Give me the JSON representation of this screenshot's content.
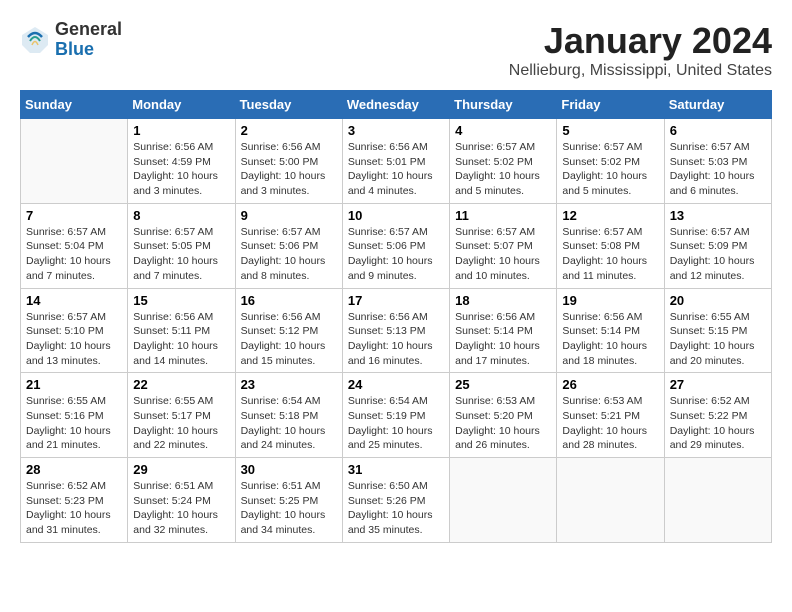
{
  "header": {
    "logo": {
      "general": "General",
      "blue": "Blue"
    },
    "month": "January 2024",
    "location": "Nellieburg, Mississippi, United States"
  },
  "calendar": {
    "weekdays": [
      "Sunday",
      "Monday",
      "Tuesday",
      "Wednesday",
      "Thursday",
      "Friday",
      "Saturday"
    ],
    "weeks": [
      [
        {
          "day": "",
          "sunrise": "",
          "sunset": "",
          "daylight": ""
        },
        {
          "day": "1",
          "sunrise": "Sunrise: 6:56 AM",
          "sunset": "Sunset: 4:59 PM",
          "daylight": "Daylight: 10 hours and 3 minutes."
        },
        {
          "day": "2",
          "sunrise": "Sunrise: 6:56 AM",
          "sunset": "Sunset: 5:00 PM",
          "daylight": "Daylight: 10 hours and 3 minutes."
        },
        {
          "day": "3",
          "sunrise": "Sunrise: 6:56 AM",
          "sunset": "Sunset: 5:01 PM",
          "daylight": "Daylight: 10 hours and 4 minutes."
        },
        {
          "day": "4",
          "sunrise": "Sunrise: 6:57 AM",
          "sunset": "Sunset: 5:02 PM",
          "daylight": "Daylight: 10 hours and 5 minutes."
        },
        {
          "day": "5",
          "sunrise": "Sunrise: 6:57 AM",
          "sunset": "Sunset: 5:02 PM",
          "daylight": "Daylight: 10 hours and 5 minutes."
        },
        {
          "day": "6",
          "sunrise": "Sunrise: 6:57 AM",
          "sunset": "Sunset: 5:03 PM",
          "daylight": "Daylight: 10 hours and 6 minutes."
        }
      ],
      [
        {
          "day": "7",
          "sunrise": "Sunrise: 6:57 AM",
          "sunset": "Sunset: 5:04 PM",
          "daylight": "Daylight: 10 hours and 7 minutes."
        },
        {
          "day": "8",
          "sunrise": "Sunrise: 6:57 AM",
          "sunset": "Sunset: 5:05 PM",
          "daylight": "Daylight: 10 hours and 7 minutes."
        },
        {
          "day": "9",
          "sunrise": "Sunrise: 6:57 AM",
          "sunset": "Sunset: 5:06 PM",
          "daylight": "Daylight: 10 hours and 8 minutes."
        },
        {
          "day": "10",
          "sunrise": "Sunrise: 6:57 AM",
          "sunset": "Sunset: 5:06 PM",
          "daylight": "Daylight: 10 hours and 9 minutes."
        },
        {
          "day": "11",
          "sunrise": "Sunrise: 6:57 AM",
          "sunset": "Sunset: 5:07 PM",
          "daylight": "Daylight: 10 hours and 10 minutes."
        },
        {
          "day": "12",
          "sunrise": "Sunrise: 6:57 AM",
          "sunset": "Sunset: 5:08 PM",
          "daylight": "Daylight: 10 hours and 11 minutes."
        },
        {
          "day": "13",
          "sunrise": "Sunrise: 6:57 AM",
          "sunset": "Sunset: 5:09 PM",
          "daylight": "Daylight: 10 hours and 12 minutes."
        }
      ],
      [
        {
          "day": "14",
          "sunrise": "Sunrise: 6:57 AM",
          "sunset": "Sunset: 5:10 PM",
          "daylight": "Daylight: 10 hours and 13 minutes."
        },
        {
          "day": "15",
          "sunrise": "Sunrise: 6:56 AM",
          "sunset": "Sunset: 5:11 PM",
          "daylight": "Daylight: 10 hours and 14 minutes."
        },
        {
          "day": "16",
          "sunrise": "Sunrise: 6:56 AM",
          "sunset": "Sunset: 5:12 PM",
          "daylight": "Daylight: 10 hours and 15 minutes."
        },
        {
          "day": "17",
          "sunrise": "Sunrise: 6:56 AM",
          "sunset": "Sunset: 5:13 PM",
          "daylight": "Daylight: 10 hours and 16 minutes."
        },
        {
          "day": "18",
          "sunrise": "Sunrise: 6:56 AM",
          "sunset": "Sunset: 5:14 PM",
          "daylight": "Daylight: 10 hours and 17 minutes."
        },
        {
          "day": "19",
          "sunrise": "Sunrise: 6:56 AM",
          "sunset": "Sunset: 5:14 PM",
          "daylight": "Daylight: 10 hours and 18 minutes."
        },
        {
          "day": "20",
          "sunrise": "Sunrise: 6:55 AM",
          "sunset": "Sunset: 5:15 PM",
          "daylight": "Daylight: 10 hours and 20 minutes."
        }
      ],
      [
        {
          "day": "21",
          "sunrise": "Sunrise: 6:55 AM",
          "sunset": "Sunset: 5:16 PM",
          "daylight": "Daylight: 10 hours and 21 minutes."
        },
        {
          "day": "22",
          "sunrise": "Sunrise: 6:55 AM",
          "sunset": "Sunset: 5:17 PM",
          "daylight": "Daylight: 10 hours and 22 minutes."
        },
        {
          "day": "23",
          "sunrise": "Sunrise: 6:54 AM",
          "sunset": "Sunset: 5:18 PM",
          "daylight": "Daylight: 10 hours and 24 minutes."
        },
        {
          "day": "24",
          "sunrise": "Sunrise: 6:54 AM",
          "sunset": "Sunset: 5:19 PM",
          "daylight": "Daylight: 10 hours and 25 minutes."
        },
        {
          "day": "25",
          "sunrise": "Sunrise: 6:53 AM",
          "sunset": "Sunset: 5:20 PM",
          "daylight": "Daylight: 10 hours and 26 minutes."
        },
        {
          "day": "26",
          "sunrise": "Sunrise: 6:53 AM",
          "sunset": "Sunset: 5:21 PM",
          "daylight": "Daylight: 10 hours and 28 minutes."
        },
        {
          "day": "27",
          "sunrise": "Sunrise: 6:52 AM",
          "sunset": "Sunset: 5:22 PM",
          "daylight": "Daylight: 10 hours and 29 minutes."
        }
      ],
      [
        {
          "day": "28",
          "sunrise": "Sunrise: 6:52 AM",
          "sunset": "Sunset: 5:23 PM",
          "daylight": "Daylight: 10 hours and 31 minutes."
        },
        {
          "day": "29",
          "sunrise": "Sunrise: 6:51 AM",
          "sunset": "Sunset: 5:24 PM",
          "daylight": "Daylight: 10 hours and 32 minutes."
        },
        {
          "day": "30",
          "sunrise": "Sunrise: 6:51 AM",
          "sunset": "Sunset: 5:25 PM",
          "daylight": "Daylight: 10 hours and 34 minutes."
        },
        {
          "day": "31",
          "sunrise": "Sunrise: 6:50 AM",
          "sunset": "Sunset: 5:26 PM",
          "daylight": "Daylight: 10 hours and 35 minutes."
        },
        {
          "day": "",
          "sunrise": "",
          "sunset": "",
          "daylight": ""
        },
        {
          "day": "",
          "sunrise": "",
          "sunset": "",
          "daylight": ""
        },
        {
          "day": "",
          "sunrise": "",
          "sunset": "",
          "daylight": ""
        }
      ]
    ]
  }
}
